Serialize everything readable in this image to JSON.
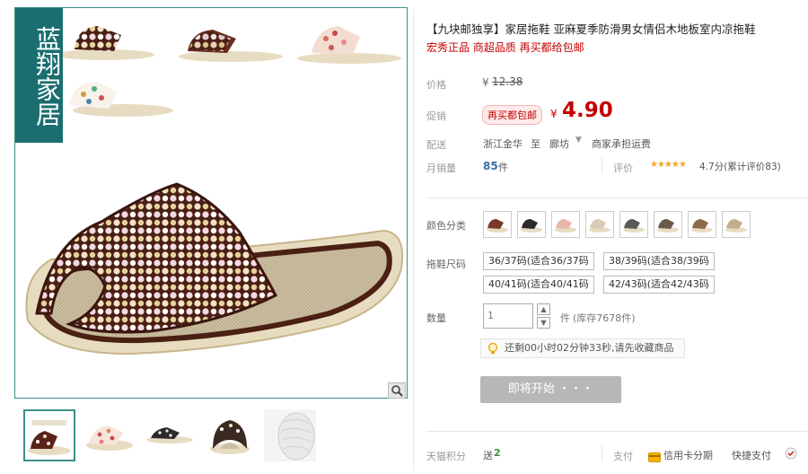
{
  "brand": {
    "text": "蓝翔家居"
  },
  "product": {
    "title": "【九块邮独享】家居拖鞋 亚麻夏季防滑男女情侣木地板室内凉拖鞋",
    "subtitle": "宏秀正品 商超品质 再买都给包邮"
  },
  "price": {
    "label": "价格",
    "currency": "¥",
    "original": "12.38",
    "promo_label": "促销",
    "promo_badge": "再买都包邮",
    "promo_value": "4.90"
  },
  "shipping": {
    "label": "配送",
    "from": "浙江金华",
    "to_word": "至",
    "destination": "廊坊",
    "note": "商家承担运费"
  },
  "sales": {
    "label": "月销量",
    "count": "85",
    "unit": "件",
    "rating_label": "评价",
    "stars": "★★★★★",
    "rating_text": "4.7分(累计评价83)"
  },
  "options": {
    "color_label": "颜色分类",
    "size_label": "拖鞋尺码",
    "sizes": [
      "36/37码(适合36/37码",
      "38/39码(适合38/39码",
      "40/41码(适合40/41码",
      "42/43码(适合42/43码"
    ]
  },
  "quantity": {
    "label": "数量",
    "value": "1",
    "unit": "件",
    "stock": "(库存7678件)"
  },
  "notice": {
    "text": "还剩00小时02分钟33秒,请先收藏商品"
  },
  "action": {
    "start_label": "即将开始 ・・・"
  },
  "footer": {
    "points_label": "天猫积分",
    "points_text": "送",
    "points_value": "2",
    "pay_label": "支付",
    "credit_label": "信用卡分期",
    "quick_label": "快捷支付"
  },
  "colors": {
    "accent": "#c40000",
    "frame": "#3a8f8a",
    "brand_bg": "#1b6e70",
    "star": "#f5a623"
  }
}
